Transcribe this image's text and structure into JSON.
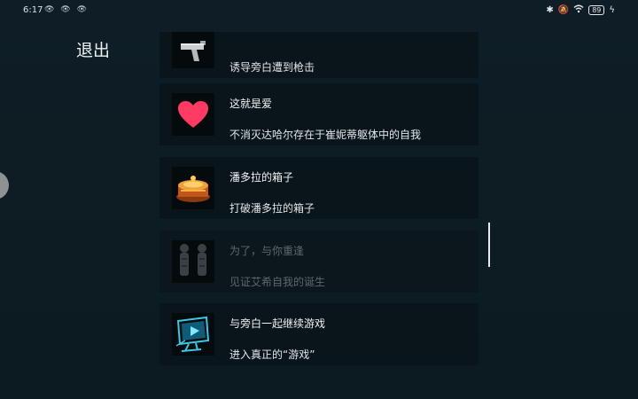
{
  "status_bar": {
    "time": "6:17",
    "notification_icons": "👁 👁 👁",
    "battery": "89",
    "icons": [
      "bluetooth-icon",
      "mute-icon",
      "wifi-icon",
      "battery-icon",
      "charging-icon"
    ]
  },
  "exit_label": "退出",
  "achievements": [
    {
      "title": "",
      "description": "诱导旁白遭到枪击",
      "icon": "gun-icon",
      "locked": false
    },
    {
      "title": "这就是爱",
      "description": "不消灭达哈尔存在于崔妮蒂躯体中的自我",
      "icon": "heart-icon",
      "locked": false
    },
    {
      "title": "潘多拉的箱子",
      "description": "打破潘多拉的箱子",
      "icon": "pandora-box-icon",
      "locked": false
    },
    {
      "title": "为了，与你重逢",
      "description": "见证艾希自我的诞生",
      "icon": "statues-icon",
      "locked": true
    },
    {
      "title": "与旁白一起继续游戏",
      "description": "进入真正的“游戏”",
      "icon": "computer-monitor-icon",
      "locked": false
    }
  ],
  "colors": {
    "background": "#0d1b22",
    "card": "#0a151b",
    "heart": "#ff3a63",
    "monitor": "#39c8e6",
    "box": "#e0841e"
  }
}
